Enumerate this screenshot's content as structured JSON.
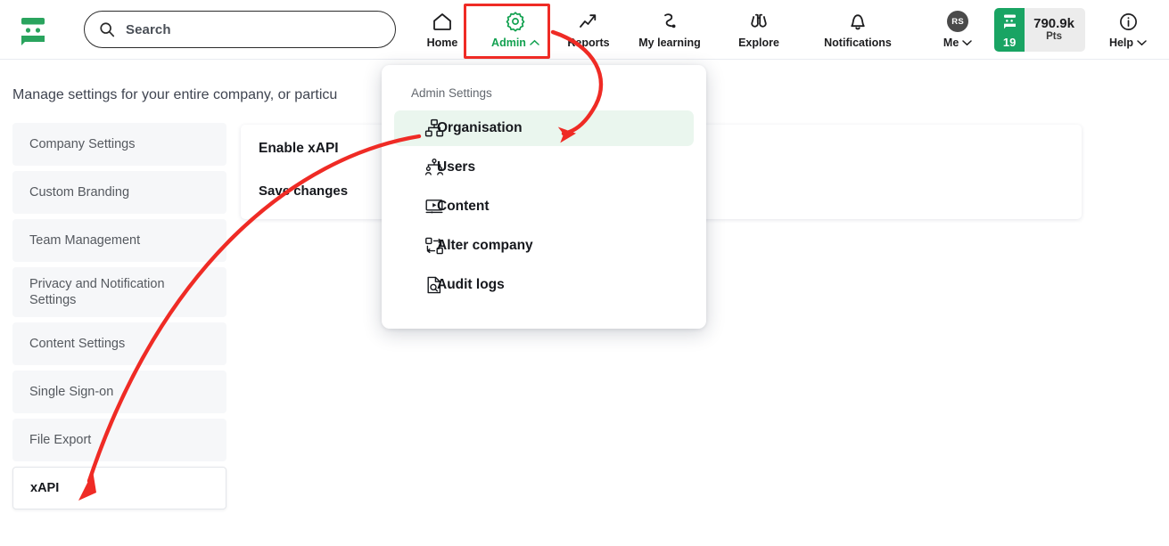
{
  "colors": {
    "brand_green": "#19a463",
    "admin_green": "#12a150",
    "annotation_red": "#ef2b25",
    "selected_bg": "#eaf6ee",
    "sidebar_bg": "#f6f7f9",
    "text_dark": "#16181d",
    "text_muted": "#55595f"
  },
  "topnav": {
    "logo_name": "brand-logo",
    "search": {
      "placeholder": "Search",
      "value": "",
      "icon": "search-icon"
    },
    "items": [
      {
        "label": "Home",
        "icon": "home-icon",
        "active": false,
        "caret": ""
      },
      {
        "label": "Admin",
        "icon": "gear-icon",
        "active": true,
        "caret": "^"
      },
      {
        "label": "Reports",
        "icon": "trending-up-icon",
        "active": false,
        "caret": ""
      },
      {
        "label": "My learning",
        "icon": "path-pin-icon",
        "active": false,
        "caret": ""
      },
      {
        "label": "Explore",
        "icon": "binoculars-icon",
        "active": false,
        "caret": ""
      },
      {
        "label": "Notifications",
        "icon": "bell-icon",
        "active": false,
        "caret": ""
      }
    ],
    "me": {
      "label": "Me",
      "avatar_initials": "RS",
      "icon": "avatar",
      "caret": "v"
    },
    "points": {
      "streak": "19",
      "value": "790.9k",
      "unit": "Pts",
      "icon": "points-card-icon"
    },
    "help": {
      "label": "Help",
      "icon": "info-circle-icon",
      "caret": "v"
    }
  },
  "page": {
    "description": "Manage settings for your entire company, or particu"
  },
  "sidebar": {
    "items": [
      {
        "label": "Company Settings",
        "active": false,
        "twoline": false
      },
      {
        "label": "Custom Branding",
        "active": false,
        "twoline": false
      },
      {
        "label": "Team Management",
        "active": false,
        "twoline": false
      },
      {
        "label": "Privacy and Notification Settings",
        "active": false,
        "twoline": true
      },
      {
        "label": "Content Settings",
        "active": false,
        "twoline": false
      },
      {
        "label": "Single Sign-on",
        "active": false,
        "twoline": false
      },
      {
        "label": "File Export",
        "active": false,
        "twoline": false
      },
      {
        "label": "xAPI",
        "active": true,
        "twoline": false
      }
    ]
  },
  "content": {
    "heading": "Enable xAPI",
    "save_label": "Save changes"
  },
  "dropdown": {
    "title": "Admin Settings",
    "items": [
      {
        "label": "Organisation",
        "icon": "org-chart-icon",
        "selected": true
      },
      {
        "label": "Users",
        "icon": "users-group-icon",
        "selected": false
      },
      {
        "label": "Content",
        "icon": "video-screen-icon",
        "selected": false
      },
      {
        "label": "Alter company",
        "icon": "swap-boxes-icon",
        "selected": false
      },
      {
        "label": "Audit logs",
        "icon": "document-search-icon",
        "selected": false
      }
    ]
  },
  "annotations": {
    "highlight_box_target": "Admin",
    "arrow_1_from": "Admin",
    "arrow_1_to": "Organisation",
    "arrow_2_from": "Organisation",
    "arrow_2_to": "xAPI"
  }
}
